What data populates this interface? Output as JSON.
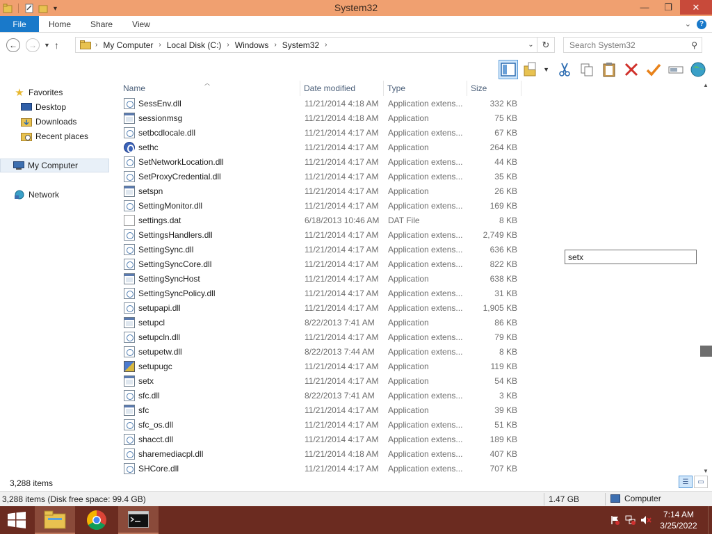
{
  "window": {
    "title": "System32"
  },
  "ribbon": {
    "tabs": [
      "File",
      "Home",
      "Share",
      "View"
    ]
  },
  "address": {
    "crumbs": [
      "My Computer",
      "Local Disk (C:)",
      "Windows",
      "System32"
    ],
    "search_placeholder": "Search System32"
  },
  "nav": {
    "favorites": "Favorites",
    "desktop": "Desktop",
    "downloads": "Downloads",
    "recent": "Recent places",
    "computer": "My Computer",
    "network": "Network"
  },
  "columns": {
    "name": "Name",
    "date": "Date modified",
    "type": "Type",
    "size": "Size"
  },
  "files": [
    {
      "name": "SessEnv.dll",
      "date": "11/21/2014 4:18 AM",
      "type": "Application extens...",
      "size": "332 KB",
      "icon": "dll"
    },
    {
      "name": "sessionmsg",
      "date": "11/21/2014 4:18 AM",
      "type": "Application",
      "size": "75 KB",
      "icon": "app"
    },
    {
      "name": "setbcdlocale.dll",
      "date": "11/21/2014 4:17 AM",
      "type": "Application extens...",
      "size": "67 KB",
      "icon": "dll"
    },
    {
      "name": "sethc",
      "date": "11/21/2014 4:17 AM",
      "type": "Application",
      "size": "264 KB",
      "icon": "sethc"
    },
    {
      "name": "SetNetworkLocation.dll",
      "date": "11/21/2014 4:17 AM",
      "type": "Application extens...",
      "size": "44 KB",
      "icon": "dll"
    },
    {
      "name": "SetProxyCredential.dll",
      "date": "11/21/2014 4:17 AM",
      "type": "Application extens...",
      "size": "35 KB",
      "icon": "dll"
    },
    {
      "name": "setspn",
      "date": "11/21/2014 4:17 AM",
      "type": "Application",
      "size": "26 KB",
      "icon": "app"
    },
    {
      "name": "SettingMonitor.dll",
      "date": "11/21/2014 4:17 AM",
      "type": "Application extens...",
      "size": "169 KB",
      "icon": "dll"
    },
    {
      "name": "settings.dat",
      "date": "6/18/2013 10:46 AM",
      "type": "DAT File",
      "size": "8 KB",
      "icon": "dat"
    },
    {
      "name": "SettingsHandlers.dll",
      "date": "11/21/2014 4:17 AM",
      "type": "Application extens...",
      "size": "2,749 KB",
      "icon": "dll"
    },
    {
      "name": "SettingSync.dll",
      "date": "11/21/2014 4:17 AM",
      "type": "Application extens...",
      "size": "636 KB",
      "icon": "dll"
    },
    {
      "name": "SettingSyncCore.dll",
      "date": "11/21/2014 4:17 AM",
      "type": "Application extens...",
      "size": "822 KB",
      "icon": "dll"
    },
    {
      "name": "SettingSyncHost",
      "date": "11/21/2014 4:17 AM",
      "type": "Application",
      "size": "638 KB",
      "icon": "app"
    },
    {
      "name": "SettingSyncPolicy.dll",
      "date": "11/21/2014 4:17 AM",
      "type": "Application extens...",
      "size": "31 KB",
      "icon": "dll"
    },
    {
      "name": "setupapi.dll",
      "date": "11/21/2014 4:17 AM",
      "type": "Application extens...",
      "size": "1,905 KB",
      "icon": "dll"
    },
    {
      "name": "setupcl",
      "date": "8/22/2013 7:41 AM",
      "type": "Application",
      "size": "86 KB",
      "icon": "app"
    },
    {
      "name": "setupcln.dll",
      "date": "11/21/2014 4:17 AM",
      "type": "Application extens...",
      "size": "79 KB",
      "icon": "dll"
    },
    {
      "name": "setupetw.dll",
      "date": "8/22/2013 7:44 AM",
      "type": "Application extens...",
      "size": "8 KB",
      "icon": "dll"
    },
    {
      "name": "setupugc",
      "date": "11/21/2014 4:17 AM",
      "type": "Application",
      "size": "119 KB",
      "icon": "ugc"
    },
    {
      "name": "setx",
      "date": "11/21/2014 4:17 AM",
      "type": "Application",
      "size": "54 KB",
      "icon": "app"
    },
    {
      "name": "sfc.dll",
      "date": "8/22/2013 7:41 AM",
      "type": "Application extens...",
      "size": "3 KB",
      "icon": "dll"
    },
    {
      "name": "sfc",
      "date": "11/21/2014 4:17 AM",
      "type": "Application",
      "size": "39 KB",
      "icon": "app"
    },
    {
      "name": "sfc_os.dll",
      "date": "11/21/2014 4:17 AM",
      "type": "Application extens...",
      "size": "51 KB",
      "icon": "dll"
    },
    {
      "name": "shacct.dll",
      "date": "11/21/2014 4:17 AM",
      "type": "Application extens...",
      "size": "189 KB",
      "icon": "dll"
    },
    {
      "name": "sharemediacpl.dll",
      "date": "11/21/2014 4:18 AM",
      "type": "Application extens...",
      "size": "407 KB",
      "icon": "dll"
    },
    {
      "name": "SHCore.dll",
      "date": "11/21/2014 4:17 AM",
      "type": "Application extens...",
      "size": "707 KB",
      "icon": "dll"
    }
  ],
  "floatbox": {
    "value": "setx"
  },
  "scroll": {
    "position": 0.69
  },
  "status": {
    "items": "3,288 items",
    "detail": "3,288 items (Disk free space: 99.4 GB)",
    "size": "1.47 GB",
    "location": "Computer"
  },
  "clock": {
    "time": "7:14 AM",
    "date": "3/25/2022"
  },
  "colors": {
    "titlebar": "#f0a070",
    "file_tab": "#1979ca",
    "taskbar": "#6b2b20"
  }
}
